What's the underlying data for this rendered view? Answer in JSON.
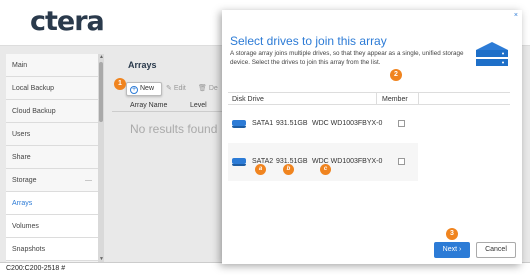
{
  "app": {
    "logo": "ctera",
    "status_text": "C200:C200-2518 #"
  },
  "sidebar": {
    "items": [
      {
        "label": "Main"
      },
      {
        "label": "Local Backup"
      },
      {
        "label": "Cloud Backup"
      },
      {
        "label": "Users"
      },
      {
        "label": "Share"
      },
      {
        "label": "Storage"
      },
      {
        "label": "Arrays"
      },
      {
        "label": "Volumes"
      },
      {
        "label": "Snapshots"
      }
    ]
  },
  "content": {
    "title": "Arrays",
    "toolbar": {
      "new_label": "New",
      "edit_label": "Edit",
      "delete_label": "De"
    },
    "columns": [
      "Array Name",
      "Level"
    ],
    "empty_text": "No results found"
  },
  "dialog": {
    "title": "Select drives to join this array",
    "description": "A storage array joins multiple drives, so that they appear as a single, unified storage device. Select the drives to join this array from the list.",
    "columns": {
      "disk": "Disk Drive",
      "member": "Member"
    },
    "drives": [
      {
        "name": "SATA1",
        "capacity": "931.51GB",
        "model": "WDC WD1003FBYX-0"
      },
      {
        "name": "SATA2",
        "capacity": "931.51GB",
        "model": "WDC WD1003FBYX-0"
      }
    ],
    "next_label": "Next ›",
    "cancel_label": "Cancel",
    "close_glyph": "×"
  },
  "badges": {
    "one": "1",
    "two": "2",
    "three": "3",
    "a": "a",
    "b": "b",
    "c": "c"
  },
  "colors": {
    "accent": "#2c7bd6",
    "badge": "#f0841f"
  }
}
